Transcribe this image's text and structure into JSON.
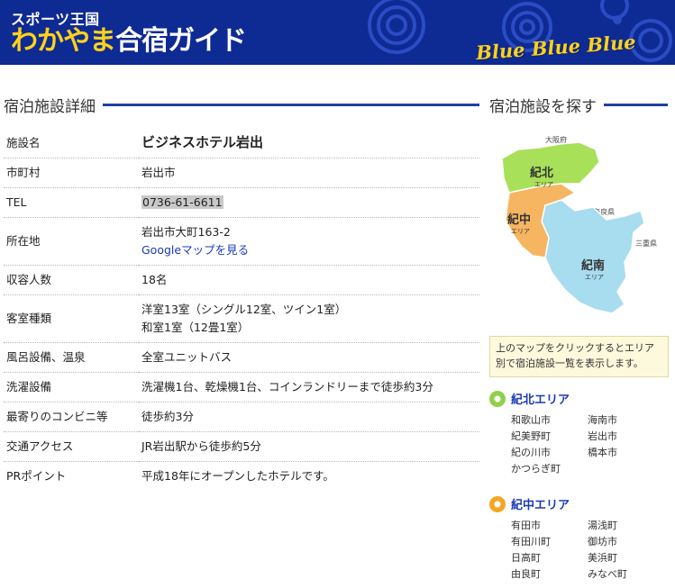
{
  "header": {
    "brand_small": "スポーツ王国",
    "brand_wakayama": "わかやま",
    "brand_guide": "合宿ガイド",
    "logo_text": "Blue Blue Blue"
  },
  "main": {
    "heading": "宿泊施設詳細",
    "rows": [
      {
        "label": "施設名",
        "value": "ビジネスホテル岩出"
      },
      {
        "label": "市町村",
        "value": "岩出市"
      },
      {
        "label": "TEL",
        "value": "0736-61-6611"
      },
      {
        "label": "所在地",
        "value": "岩出市大町163-2",
        "link": "Googleマップを見る"
      },
      {
        "label": "収容人数",
        "value": "18名"
      },
      {
        "label": "客室種類",
        "value": "洋室13室（シングル12室、ツイン1室）",
        "value2": "和室1室（12畳1室）"
      },
      {
        "label": "風呂設備、温泉",
        "value": "全室ユニットバス"
      },
      {
        "label": "洗濯設備",
        "value": "洗濯機1台、乾燥機1台、コインランドリーまで徒歩約3分"
      },
      {
        "label": "最寄りのコンビニ等",
        "value": "徒歩約3分"
      },
      {
        "label": "交通アクセス",
        "value": "JR岩出駅から徒歩約5分"
      },
      {
        "label": "PRポイント",
        "value": "平成18年にオープンしたホテルです。"
      }
    ]
  },
  "sidebar": {
    "heading": "宿泊施設を探す",
    "map": {
      "osaka": "大阪府",
      "nara": "奈良県",
      "mie": "三重県",
      "kihoku": "紀北",
      "kichu": "紀中",
      "kinan": "紀南",
      "area_sub": "エリア",
      "kihoku_color": "#a8e05a",
      "kichu_color": "#f6b560",
      "kinan_color": "#a8dcef"
    },
    "info": "上のマップをクリックするとエリア別で宿泊施設一覧を表示します。",
    "areas": [
      {
        "title": "紀北エリア",
        "color": "#8fd14a",
        "cities": [
          "和歌山市",
          "海南市",
          "紀美野町",
          "岩出市",
          "紀の川市",
          "橋本市",
          "かつらぎ町"
        ]
      },
      {
        "title": "紀中エリア",
        "color": "#f5a623",
        "cities": [
          "有田市",
          "湯浅町",
          "有田川町",
          "御坊市",
          "日高町",
          "美浜町",
          "由良町",
          "みなべ町"
        ]
      }
    ]
  }
}
